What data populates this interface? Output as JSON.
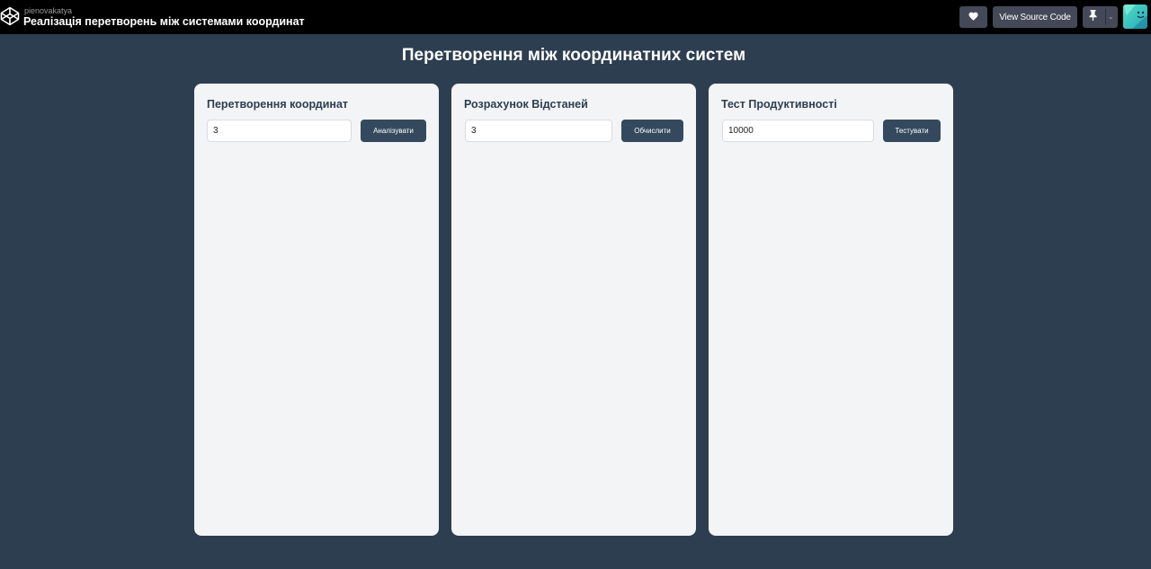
{
  "header": {
    "author": "pienovakatya",
    "title": "Реалізація перетворень між системами координат",
    "logo_icon": "codepen-logo-icon",
    "heart_icon": "heart-icon",
    "view_source_label": "View Source Code",
    "pin_icon": "pin-icon",
    "pin_dropdown_icon": "chevron-down-icon",
    "avatar_icon": "user-avatar"
  },
  "main": {
    "title": "Перетворення між координатних систем"
  },
  "cards": [
    {
      "title": "Перетворення координат",
      "input_value": "3",
      "button_label": "Аналізувати"
    },
    {
      "title": "Розрахунок Відстаней",
      "input_value": "3",
      "button_label": "Обчислити"
    },
    {
      "title": "Тест Продуктивності",
      "input_value": "10000",
      "button_label": "Тестувати"
    }
  ],
  "colors": {
    "background": "#2d3e50",
    "card": "#f3f4f6",
    "button": "#34495e",
    "topbar": "#000000"
  }
}
